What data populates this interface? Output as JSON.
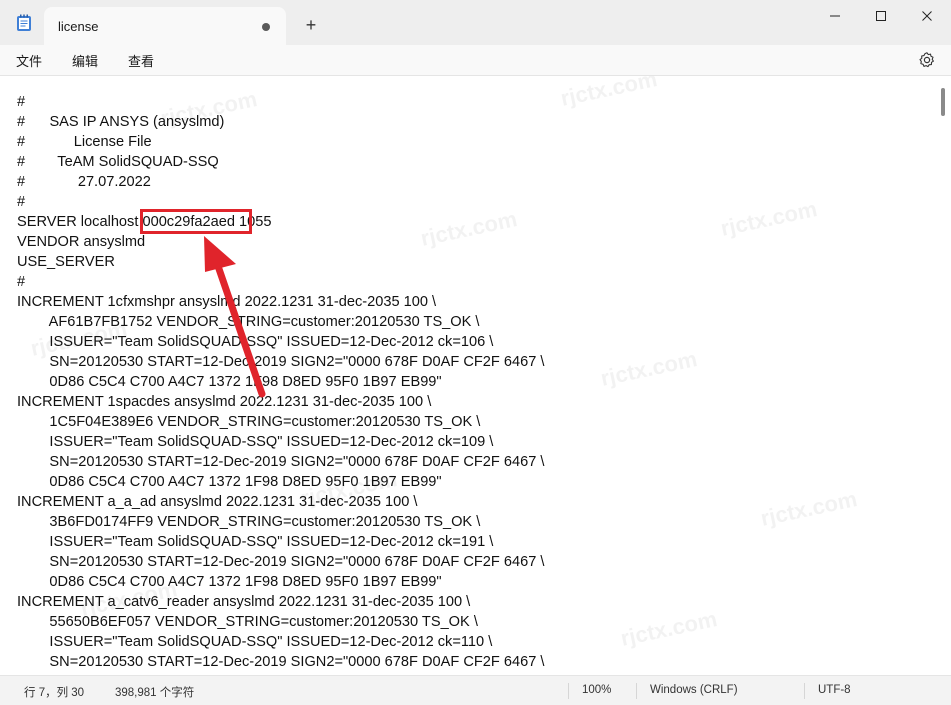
{
  "window": {
    "tab_title": "license",
    "new_tab_label": "+"
  },
  "menu": {
    "file": "文件",
    "edit": "编辑",
    "view": "查看"
  },
  "editor": {
    "lines": [
      "#",
      "#      SAS IP ANSYS (ansyslmd)",
      "#            License File",
      "#        TeAM SolidSQUAD-SSQ",
      "#             27.07.2022",
      "#",
      "SERVER localhost 000c29fa2aed 1055",
      "VENDOR ansyslmd",
      "USE_SERVER",
      "#",
      "INCREMENT 1cfxmshpr ansyslmd 2022.1231 31-dec-2035 100 \\",
      "        AF61B7FB1752 VENDOR_STRING=customer:20120530 TS_OK \\",
      "        ISSUER=\"Team SolidSQUAD-SSQ\" ISSUED=12-Dec-2012 ck=106 \\",
      "        SN=20120530 START=12-Dec-2019 SIGN2=\"0000 678F D0AF CF2F 6467 \\",
      "        0D86 C5C4 C700 A4C7 1372 1F98 D8ED 95F0 1B97 EB99\"",
      "INCREMENT 1spacdes ansyslmd 2022.1231 31-dec-2035 100 \\",
      "        1C5F04E389E6 VENDOR_STRING=customer:20120530 TS_OK \\",
      "        ISSUER=\"Team SolidSQUAD-SSQ\" ISSUED=12-Dec-2012 ck=109 \\",
      "        SN=20120530 START=12-Dec-2019 SIGN2=\"0000 678F D0AF CF2F 6467 \\",
      "        0D86 C5C4 C700 A4C7 1372 1F98 D8ED 95F0 1B97 EB99\"",
      "INCREMENT a_a_ad ansyslmd 2022.1231 31-dec-2035 100 \\",
      "        3B6FD0174FF9 VENDOR_STRING=customer:20120530 TS_OK \\",
      "        ISSUER=\"Team SolidSQUAD-SSQ\" ISSUED=12-Dec-2012 ck=191 \\",
      "        SN=20120530 START=12-Dec-2019 SIGN2=\"0000 678F D0AF CF2F 6467 \\",
      "        0D86 C5C4 C700 A4C7 1372 1F98 D8ED 95F0 1B97 EB99\"",
      "INCREMENT a_catv6_reader ansyslmd 2022.1231 31-dec-2035 100 \\",
      "        55650B6EF057 VENDOR_STRING=customer:20120530 TS_OK \\",
      "        ISSUER=\"Team SolidSQUAD-SSQ\" ISSUED=12-Dec-2012 ck=110 \\",
      "        SN=20120530 START=12-Dec-2019 SIGN2=\"0000 678F D0AF CF2F 6467 \\"
    ],
    "watermark": "rjctx.com"
  },
  "status": {
    "position": "行 7，列 30",
    "char_count": "398,981 个字符",
    "zoom": "100%",
    "line_ending": "Windows (CRLF)",
    "encoding": "UTF-8"
  },
  "colors": {
    "annotation_red": "#e0242b"
  }
}
